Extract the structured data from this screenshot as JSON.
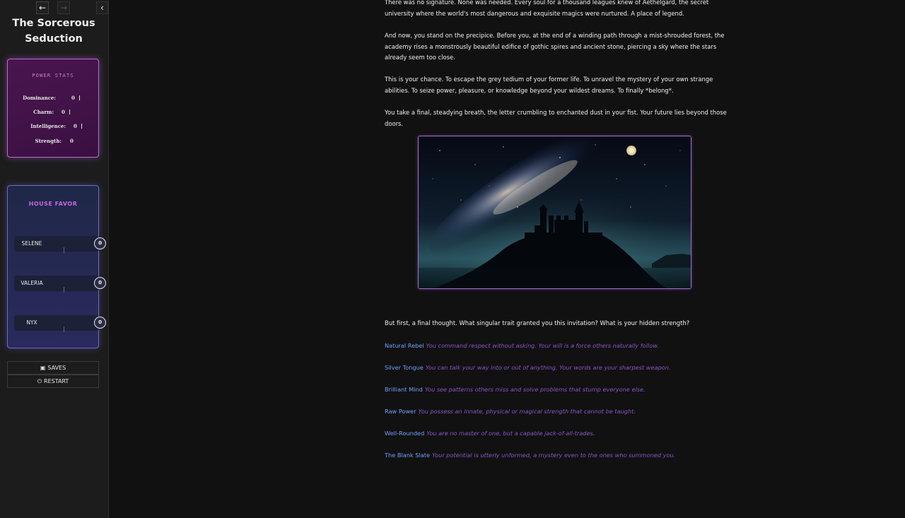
{
  "sidebar": {
    "nav_back_icon": "arrow-left-icon",
    "nav_back": "🡐",
    "nav_forward": "🡒",
    "stow": "‹",
    "title_line1": "The Sorcerous",
    "title_line2": "Seduction",
    "power_stats": {
      "title": "POWER STATS",
      "stats": [
        {
          "label": "Dominance:",
          "value": "0"
        },
        {
          "label": "Charm:",
          "value": "0"
        },
        {
          "label": "Intelligence:",
          "value": "0"
        },
        {
          "label": "Strength:",
          "value": "0"
        }
      ]
    },
    "house_favor": {
      "title": "HOUSE FAVOR",
      "members": [
        {
          "name": "SELENE",
          "value": "0"
        },
        {
          "name": "VALERIA",
          "value": "0"
        },
        {
          "name": "NYX",
          "value": "0"
        }
      ]
    },
    "saves_label": "SAVES",
    "saves_icon": "floppy-disk-icon",
    "restart_label": "RESTART",
    "restart_icon": "power-icon"
  },
  "passage": {
    "paragraphs": [
      "There was no signature. None was needed. Every soul for a thousand leagues knew of Aethelgard, the secret university where the world's most dangerous and exquisite magics were nurtured. A place of legend.",
      "And now, you stand on the precipice. Before you, at the end of a winding path through a mist-shrouded forest, the academy rises a monstrously beautiful edifice of gothic spires and ancient stone, piercing a sky where the stars already seem too close.",
      "This is your chance. To escape the grey tedium of your former life. To unravel the mystery of your own strange abilities. To seize power, pleasure, or knowledge beyond your wildest dreams. To finally *belong*.",
      "You take a final, steadying breath, the letter crumbling to enchanted dust in your fist. Your future lies beyond those doors.",
      "But first, a final thought. What singular trait granted you this invitation? What is your hidden strength?"
    ],
    "choices": [
      {
        "label": "Natural Rebel",
        "desc": "You command respect without asking. Your will is a force others naturally follow."
      },
      {
        "label": "Silver Tongue",
        "desc": "You can talk your way into or out of anything. Your words are your sharpest weapon."
      },
      {
        "label": "Brilliant Mind",
        "desc": "You see patterns others miss and solve problems that stump everyone else."
      },
      {
        "label": "Raw Power",
        "desc": "You possess an innate, physical or magical strength that cannot be taught."
      },
      {
        "label": "Well-Rounded",
        "desc": "You are no master of one, but a capable jack-of-all-trades."
      },
      {
        "label": "The Blank Slate",
        "desc": "Your potential is utterly unformed, a mystery even to the ones who summoned you."
      }
    ]
  },
  "colors": {
    "power_panel_border": "#b66dd6",
    "favor_panel_border": "#6c6ac8",
    "choice_link": "#6fa0ff",
    "choice_desc": "#8a54c8"
  }
}
